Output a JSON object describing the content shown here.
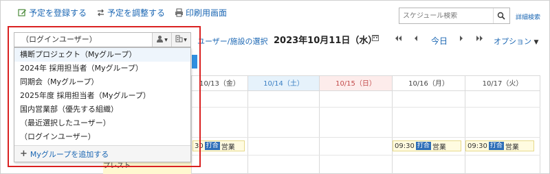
{
  "toolbar": {
    "register_label": "予定を登録する",
    "adjust_label": "予定を調整する",
    "print_label": "印刷用画面"
  },
  "search": {
    "placeholder": "スケジュール検索",
    "advanced_label": "詳細検索"
  },
  "picker": {
    "selected": "（ログインユーザー）"
  },
  "dropdown": {
    "items": [
      "横断プロジェクト（Myグループ）",
      "2024年 採用担当者（Myグループ）",
      "同期会（Myグループ）",
      "2025年度 採用担当者（Myグループ）",
      "国内営業部（優先する組織）",
      "（最近選択したユーザー）",
      "（ログインユーザー）"
    ],
    "add_label": "Myグループを追加する"
  },
  "nav": {
    "user_facility_label": "ユーザー/施設の選択",
    "date_title": "2023年10月11日（水）",
    "today_label": "今日",
    "options_label": "オプション"
  },
  "calendar": {
    "days": [
      {
        "label": "10/13（金）",
        "type": "weekday"
      },
      {
        "label": "10/14（土）",
        "type": "sat"
      },
      {
        "label": "10/15（日）",
        "type": "sun"
      },
      {
        "label": "10/16（月）",
        "type": "weekday"
      },
      {
        "label": "10/17（火）",
        "type": "weekday"
      }
    ],
    "events": [
      {
        "time": "30",
        "tag": "打合",
        "title": "営業"
      },
      {
        "time": "09:30",
        "tag": "打合",
        "title": "営業"
      },
      {
        "time": "09:30",
        "tag": "打合",
        "title": "営業"
      }
    ],
    "partial_text": "プレスト"
  },
  "colors": {
    "link": "#1a66b3",
    "highlight_border": "#d92020",
    "tag_bg": "#2f6fb8"
  }
}
